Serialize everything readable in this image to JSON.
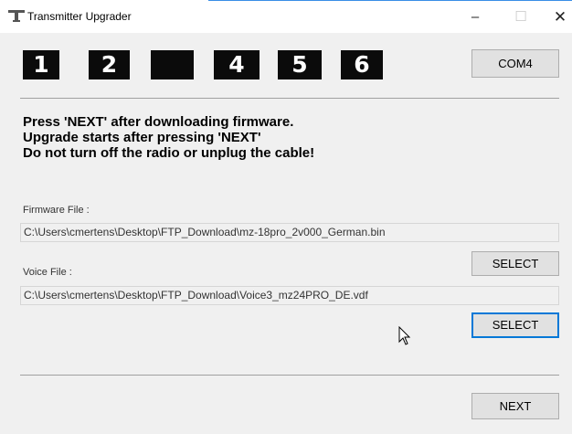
{
  "window": {
    "title": "Transmitter Upgrader",
    "controls": {
      "minimize": "–",
      "maximize": "☐",
      "close": "✕"
    }
  },
  "steps": [
    "1",
    "2",
    "",
    "4",
    "5",
    "6"
  ],
  "com_port_button": "COM4",
  "instructions": [
    "Press 'NEXT' after downloading firmware.",
    "Upgrade starts after pressing 'NEXT'",
    "Do not turn off the radio or unplug the cable!"
  ],
  "firmware": {
    "label": "Firmware File :",
    "path": "C:\\Users\\cmertens\\Desktop\\FTP_Download\\mz-18pro_2v000_German.bin",
    "select_label": "SELECT"
  },
  "voice": {
    "label": "Voice File :",
    "path": "C:\\Users\\cmertens\\Desktop\\FTP_Download\\Voice3_mz24PRO_DE.vdf",
    "select_label": "SELECT"
  },
  "next_button": "NEXT",
  "colors": {
    "accent": "#0078d7",
    "step_box": "#0b0b0b",
    "background": "#f0f0f0"
  },
  "icons": {
    "app": "transmitter-icon",
    "cursor": "mouse-pointer-icon"
  }
}
